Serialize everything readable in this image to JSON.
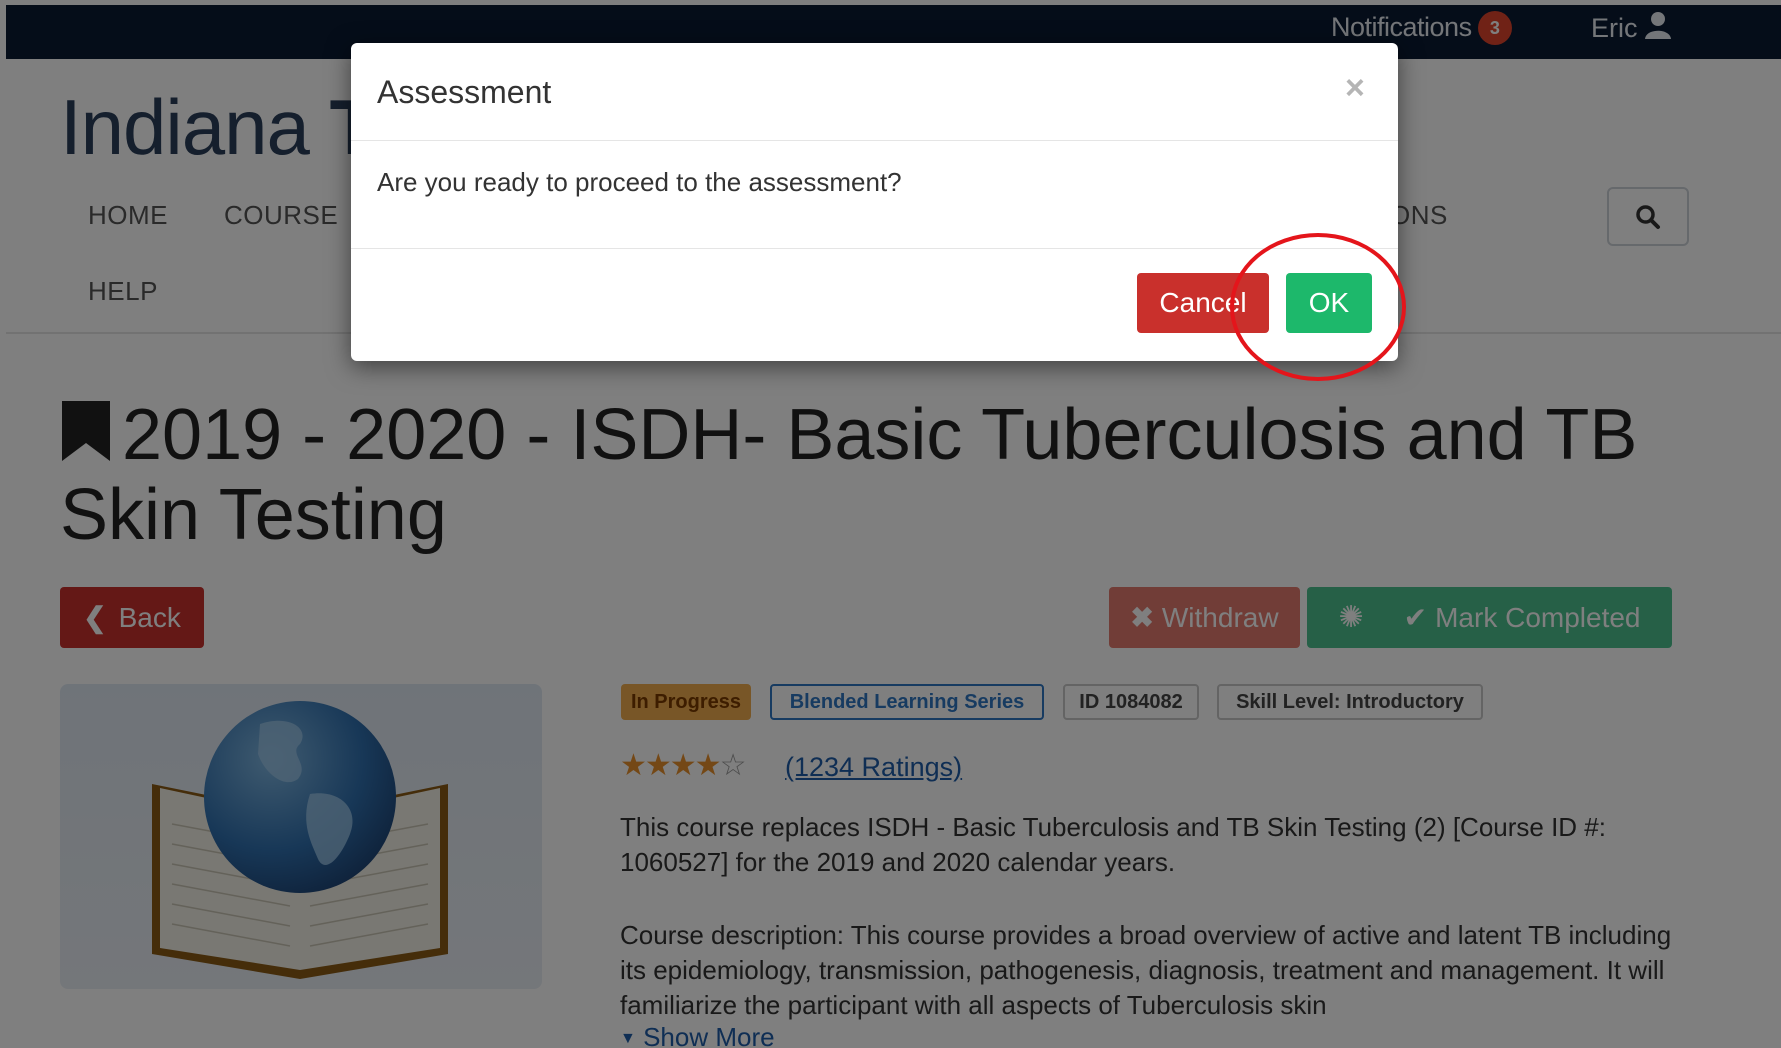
{
  "topbar": {
    "notifications_label": "Notifications",
    "notifications_count": "3",
    "user_name": "Eric"
  },
  "header": {
    "site_title_start": "Indiana ",
    "site_title_bold": "T",
    "nav": {
      "home": "HOME",
      "courses": "COURSE",
      "tail": "ONS",
      "help": "HELP"
    }
  },
  "course": {
    "title": "2019 - 2020 - ISDH- Basic Tuberculosis and TB Skin Testing",
    "back_label": "Back",
    "withdraw_label": "Withdraw",
    "complete_label": "Mark Completed",
    "tags": {
      "status": "In Progress",
      "series": "Blended Learning Series",
      "id": "ID 1084082",
      "skill": "Skill Level: Introductory"
    },
    "rating_stars": 4,
    "rating_max": 5,
    "ratings_label": "(1234 Ratings)",
    "description_1": "This course replaces ISDH - Basic Tuberculosis and TB Skin Testing (2) [Course ID #: 1060527] for the 2019 and 2020 calendar years.",
    "description_2": "Course description: This course provides a broad overview of active and latent TB including its epidemiology, transmission, pathogenesis, diagnosis, treatment and management. It will familiarize the participant with all aspects of Tuberculosis skin",
    "show_more": "Show More"
  },
  "modal": {
    "title": "Assessment",
    "close": "×",
    "message": "Are you ready to proceed to the assessment?",
    "cancel_label": "Cancel",
    "ok_label": "OK"
  },
  "colors": {
    "topbar": "#0b1a33",
    "danger": "#c9302c",
    "success": "#1db86b",
    "highlight": "#e4151b"
  }
}
